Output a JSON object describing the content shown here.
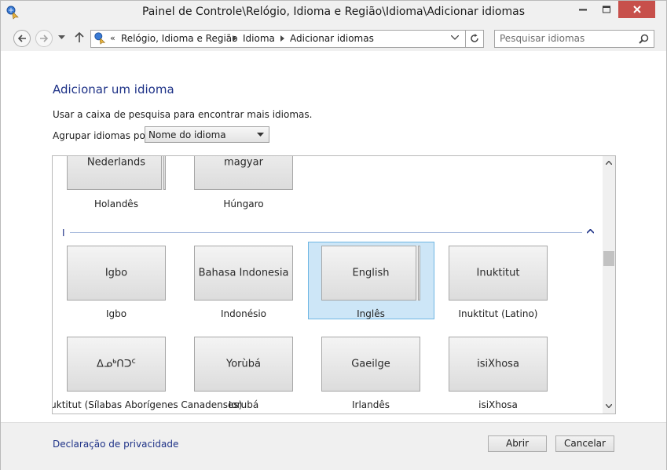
{
  "window": {
    "title": "Painel de Controle\\Relógio, Idioma e Região\\Idioma\\Adicionar idiomas",
    "accent": "#c7504b"
  },
  "nav": {
    "chevrons": "«",
    "breadcrumbs": [
      "Relógio, Idioma e Região",
      "Idioma",
      "Adicionar idiomas"
    ],
    "search_placeholder": "Pesquisar idiomas"
  },
  "main": {
    "heading": "Adicionar um idioma",
    "description": "Usar a caixa de pesquisa para encontrar mais idiomas.",
    "group_label": "Agrupar idiomas por:",
    "group_value": "Nome do idioma",
    "section_letter": "I",
    "rows": [
      [
        {
          "tile": "Nederlands",
          "name": "Holandês"
        },
        {
          "tile": "magyar",
          "name": "Húngaro"
        }
      ],
      [
        {
          "tile": "Igbo",
          "name": "Igbo"
        },
        {
          "tile": "Bahasa Indonesia",
          "name": "Indonésio"
        },
        {
          "tile": "English",
          "name": "Inglês",
          "selected": true
        },
        {
          "tile": "Inuktitut",
          "name": "Inuktitut (Latino)"
        }
      ],
      [
        {
          "tile": "ᐃᓄᒃᑎᑐᑦ",
          "name": "Inuktitut (Sílabas Aborígenes Canadenses)"
        },
        {
          "tile": "Yorùbá",
          "name": "Iorubá"
        },
        {
          "tile": "Gaeilge",
          "name": "Irlandês"
        },
        {
          "tile": "isiXhosa",
          "name": "isiXhosa"
        }
      ]
    ],
    "selection_color": "#cde6f7"
  },
  "footer": {
    "privacy_link": "Declaração de privacidade",
    "open_button": "Abrir",
    "cancel_button": "Cancelar"
  }
}
